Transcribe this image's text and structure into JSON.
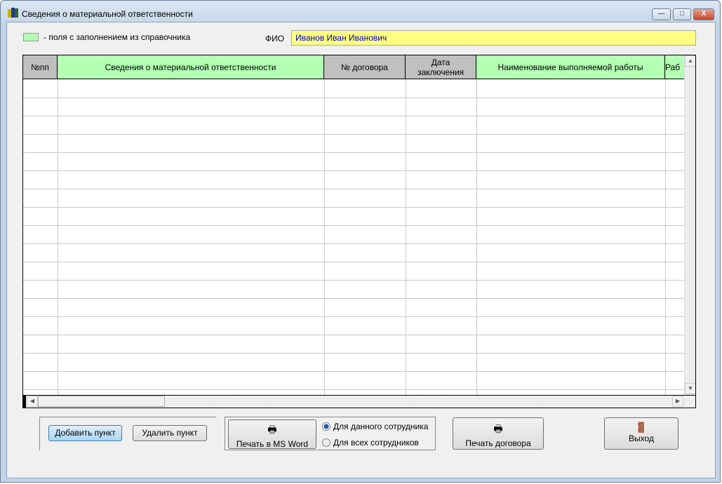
{
  "window": {
    "title": "Сведения о материальной ответственности",
    "minimize": "—",
    "maximize": "□",
    "close": "X"
  },
  "legend": {
    "text": "- поля с заполнением из справочника",
    "color": "#b3ffb3"
  },
  "fio": {
    "label": "ФИО",
    "value": "Иванов Иван Иванович"
  },
  "table": {
    "columns": [
      "№пп",
      "Сведения о материальной ответственности",
      "№ договора",
      "Дата заключения",
      "Наименование выполняемой работы",
      "Раб"
    ]
  },
  "buttons": {
    "add": "Добавить пункт",
    "delete": "Удалить пункт",
    "print_word": "Печать в MS Word",
    "print_contract": "Печать договора",
    "exit": "Выход"
  },
  "radios": {
    "this_employee": "Для данного сотрудника",
    "all_employees": "Для всех сотрудников"
  }
}
